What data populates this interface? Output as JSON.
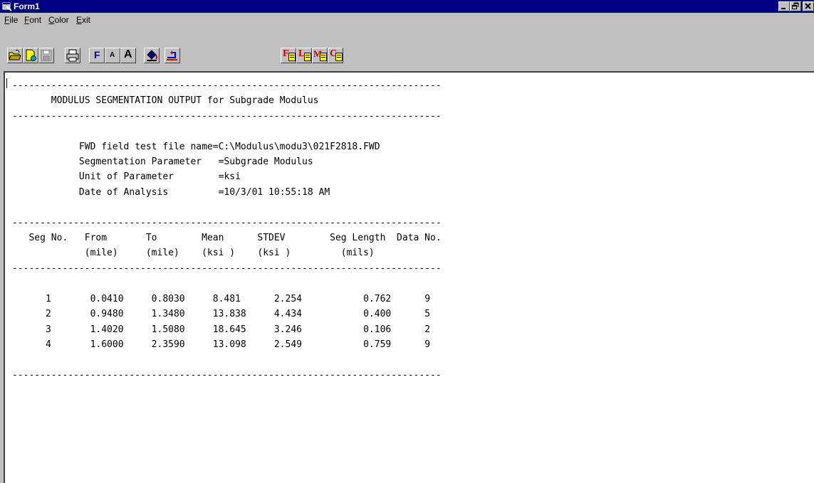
{
  "window": {
    "title": "Form1",
    "controls": [
      "_",
      "▫",
      "×"
    ]
  },
  "menu": {
    "items": [
      {
        "label": "File",
        "accel": "F",
        "rest": "ile"
      },
      {
        "label": "Font",
        "accel": "F",
        "rest": "ont"
      },
      {
        "label": "Color",
        "accel": "C",
        "rest": "olor"
      },
      {
        "label": "Exit",
        "accel": "E",
        "rest": "xit"
      }
    ]
  },
  "toolbar": {
    "font_button": "F",
    "smaller_font_button": "A",
    "larger_font_button": "A",
    "file_buttons": [
      "F",
      "L",
      "M",
      "C"
    ]
  },
  "report": {
    "separator": "-----------------------------------------------------------------------------",
    "title": "MODULUS SEGMENTATION OUTPUT for Subgrade Modulus",
    "info": [
      {
        "label": "FWD field test file name",
        "value": "C:\\Modulus\\modu3\\021F2818.FWD"
      },
      {
        "label": "Segmentation Parameter",
        "value": "Subgrade Modulus"
      },
      {
        "label": "Unit of Parameter",
        "value": "ksi"
      },
      {
        "label": "Date of Analysis",
        "value": "10/3/01 10:55:18 AM"
      }
    ],
    "header_line1": "Seg No.   From       To        Mean      STDEV        Seg Length  Data No.",
    "header_line2": "          (mile)     (mile)    (ksi )    (ksi )         (mils)",
    "rows": [
      {
        "seg": "1",
        "from": "0.0410",
        "to": "0.8030",
        "mean": "8.481",
        "stdev": "2.254",
        "seg_length": "0.762",
        "data_no": "9"
      },
      {
        "seg": "2",
        "from": "0.9480",
        "to": "1.3480",
        "mean": "13.838",
        "stdev": "4.434",
        "seg_length": "0.400",
        "data_no": "5"
      },
      {
        "seg": "3",
        "from": "1.4020",
        "to": "1.5080",
        "mean": "18.645",
        "stdev": "3.246",
        "seg_length": "0.106",
        "data_no": "2"
      },
      {
        "seg": "4",
        "from": "1.6000",
        "to": "2.3590",
        "mean": "13.098",
        "stdev": "2.549",
        "seg_length": "0.759",
        "data_no": "9"
      }
    ]
  },
  "colors": {
    "titlebar": "#000080",
    "face": "#c0c0c0",
    "document": "#ffffff",
    "icon_red": "#cc0000",
    "icon_blue": "#0000cc",
    "icon_yellow": "#ffff00"
  }
}
